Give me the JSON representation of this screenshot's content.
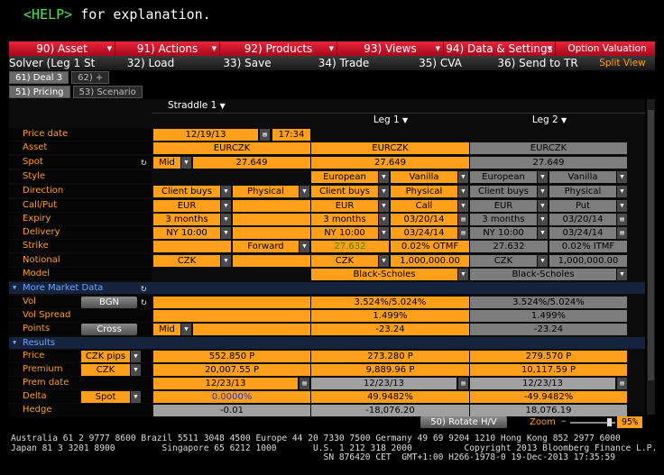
{
  "help": {
    "key": "<HELP>",
    "text": " for explanation."
  },
  "menu": [
    {
      "label": "90) Asset"
    },
    {
      "label": "91) Actions"
    },
    {
      "label": "92) Products"
    },
    {
      "label": "93) Views"
    },
    {
      "label": "94) Data & Settings"
    },
    {
      "label": "Option Valuation"
    }
  ],
  "toolbar": [
    {
      "label": "Solver (Leg 1 St"
    },
    {
      "label": "32) Load"
    },
    {
      "label": "33) Save"
    },
    {
      "label": "34) Trade"
    },
    {
      "label": "35) CVA"
    },
    {
      "label": "36) Send to TR"
    },
    {
      "label": "Split View"
    }
  ],
  "tabs": {
    "deal": "61) Deal 3",
    "plus": "62) +",
    "pricing": "51) Pricing",
    "scenario": "53) Scenario"
  },
  "structure": "Straddle 1",
  "legs": {
    "leg1": "Leg 1",
    "leg2": "Leg 2"
  },
  "rows": {
    "price_date": {
      "label": "Price date",
      "date": "12/19/13",
      "time": "17:34"
    },
    "asset": {
      "label": "Asset",
      "deal": "EURCZK",
      "leg1": "EURCZK",
      "leg2": "EURCZK"
    },
    "spot": {
      "label": "Spot",
      "side": "Mid",
      "deal": "27.649",
      "leg1": "27.649",
      "leg2": "27.649"
    },
    "style": {
      "label": "Style",
      "leg1_style": "European",
      "leg1_type": "Vanilla",
      "leg2_style": "European",
      "leg2_type": "Vanilla"
    },
    "direction": {
      "label": "Direction",
      "deal_dir": "Client buys",
      "deal_settle": "Physical",
      "leg1_dir": "Client buys",
      "leg1_settle": "Physical",
      "leg2_dir": "Client buys",
      "leg2_settle": "Physical"
    },
    "callput": {
      "label": "Call/Put",
      "deal_ccy": "EUR",
      "leg1_ccy": "EUR",
      "leg1_cp": "Call",
      "leg2_ccy": "EUR",
      "leg2_cp": "Put"
    },
    "expiry": {
      "label": "Expiry",
      "deal": "3 months",
      "leg1_tenor": "3 months",
      "leg1_date": "03/20/14",
      "leg2_tenor": "3 months",
      "leg2_date": "03/20/14"
    },
    "delivery": {
      "label": "Delivery",
      "deal": "NY 10:00",
      "leg1_cut": "NY 10:00",
      "leg1_date": "03/24/14",
      "leg2_cut": "NY 10:00",
      "leg2_date": "03/24/14"
    },
    "strike": {
      "label": "Strike",
      "deal": "Forward",
      "leg1_value": "27.632",
      "leg1_desc": "0.02% OTMF",
      "leg2_value": "27.632",
      "leg2_desc": "0.02% ITMF"
    },
    "notional": {
      "label": "Notional",
      "deal_ccy": "CZK",
      "leg1_ccy": "CZK",
      "leg1_amount": "1,000,000.00",
      "leg2_ccy": "CZK",
      "leg2_amount": "1,000,000.00"
    },
    "model": {
      "label": "Model",
      "leg1": "Black-Scholes",
      "leg2": "Black-Scholes"
    }
  },
  "more_market_data": "More Market Data",
  "market": {
    "vol": {
      "label": "Vol",
      "button": "BGN",
      "leg1": "3.524%/5.024%",
      "leg2": "3.524%/5.024%"
    },
    "vol_spread": {
      "label": "Vol Spread",
      "leg1": "1.499%",
      "leg2": "1.499%"
    },
    "points": {
      "label": "Points",
      "button": "Cross",
      "side": "Mid",
      "leg1": "-23.24",
      "leg2": "-23.24"
    }
  },
  "results_title": "Results",
  "results": {
    "price": {
      "label": "Price",
      "unit": "CZK pips",
      "deal": "552.850 P",
      "leg1": "273.280 P",
      "leg2": "279.570 P"
    },
    "premium": {
      "label": "Premium",
      "unit": "CZK",
      "deal": "20,007.55 P",
      "leg1": "9,889.96 P",
      "leg2": "10,117.59 P"
    },
    "prem_date": {
      "label": "Prem date",
      "deal": "12/23/13",
      "leg1": "12/23/13",
      "leg2": "12/23/13"
    },
    "delta": {
      "label": "Delta",
      "unit": "Spot",
      "deal": "0.0000%",
      "leg1": "49.9482%",
      "leg2": "-49.9482%"
    },
    "hedge": {
      "label": "Hedge",
      "deal": "-0.01",
      "leg1": "-18,076.20",
      "leg2": "18,076.19"
    }
  },
  "bottom": {
    "rotate": "50) Rotate H/V",
    "zoom_label": "Zoom",
    "zoom_value": "95%",
    "zoom_fraction": 0.95
  },
  "footer": {
    "line1": "Australia 61 2 9777 8600 Brazil 5511 3048 4500 Europe 44 20 7330 7500 Germany 49 69 9204 1210 Hong Kong 852 2977 6000",
    "line2": "Japan 81 3 3201 8900         Singapore 65 6212 1000       U.S. 1 212 318 2000          Copyright 2013 Bloomberg Finance L.P.",
    "line3": "                                                            SN 876420 CET  GMT+1:00 H266-1978-0 19-Dec-2013 17:35:59"
  },
  "colors": {
    "orange": "#ff9f1a",
    "red": "#d01528",
    "grey": "#7d7d7d",
    "blue": "#69a8ff",
    "green": "#4fe04f",
    "strike_green": "#3a8a00"
  }
}
